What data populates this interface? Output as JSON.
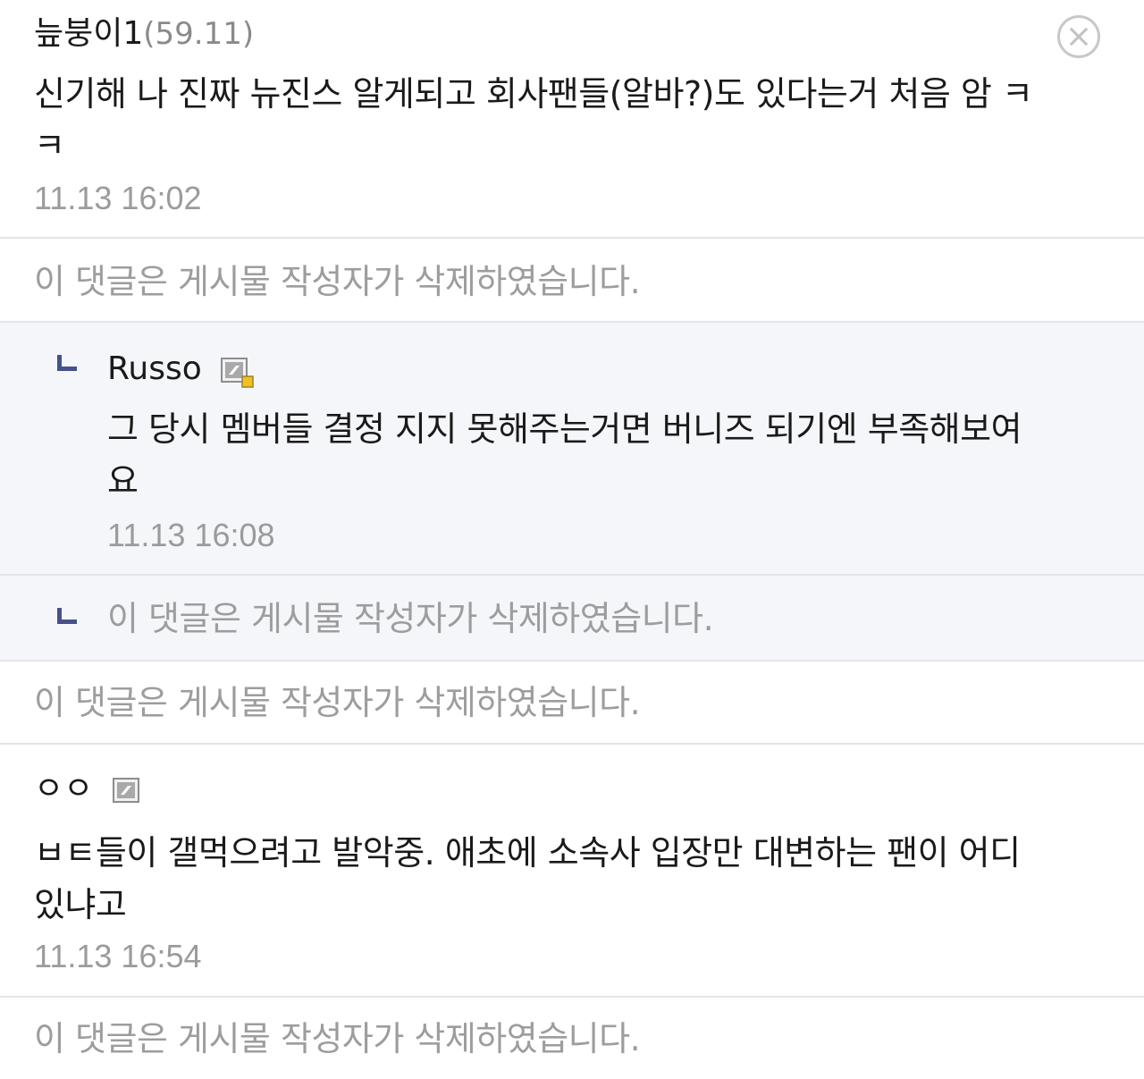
{
  "close_button": {
    "icon": "close-icon"
  },
  "comments": [
    {
      "author": "늪붕이1",
      "ip": "(59.11)",
      "text_line1": "신기해 나 진짜 뉴진스 알게되고 회사팬들(알바?)도 있다는거 처음 암 ㅋ",
      "text_line2": "ㅋ",
      "timestamp": "11.13 16:02"
    },
    {
      "deleted": "이 댓글은 게시물 작성자가 삭제하였습니다."
    },
    {
      "author": "Russo",
      "badge_icon": "fixed-member-icon",
      "text_line1": "그 당시 멤버들 결정 지지 못해주는거면 버니즈 되기엔 부족해보여",
      "text_line2": "요",
      "timestamp": "11.13 16:08"
    },
    {
      "deleted": "이 댓글은 게시물 작성자가 삭제하였습니다."
    },
    {
      "deleted": "이 댓글은 게시물 작성자가 삭제하였습니다."
    },
    {
      "author": "ㅇㅇ",
      "badge_icon": "member-icon",
      "text_line1": "ㅂㅌ들이 갤먹으려고 발악중. 애초에 소속사 입장만 대변하는 팬이 어디",
      "text_line2": "있냐고",
      "timestamp": "11.13 16:54"
    },
    {
      "deleted": "이 댓글은 게시물 작성자가 삭제하였습니다."
    }
  ],
  "colors": {
    "reply_background": "#f5f6f9",
    "reply_arrow": "#45528a",
    "deleted_text": "#9d9d9d",
    "timestamp": "#9b9b9b"
  }
}
